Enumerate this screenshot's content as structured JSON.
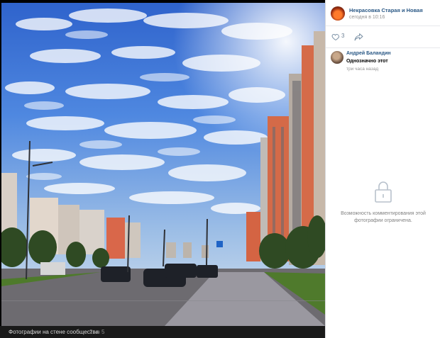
{
  "footer": {
    "title": "Фотографии на стене сообщества",
    "counter": "2 из 5"
  },
  "post": {
    "group_name": "Некрасовка Старая и Новая",
    "date": "сегодня в 10:16",
    "likes": "3"
  },
  "comments": [
    {
      "author": "Андрей Баландин",
      "text": "Однозначно этот",
      "time": "три часа назад"
    }
  ],
  "comments_restricted": {
    "text": "Возможность комментирования этой фотографии ограничена."
  },
  "icons": {
    "like": "heart-outline-icon",
    "share": "share-arrow-icon",
    "lock": "lock-icon"
  },
  "colors": {
    "link": "#2a5885",
    "muted": "#939393",
    "sky": "#3b73d9"
  }
}
